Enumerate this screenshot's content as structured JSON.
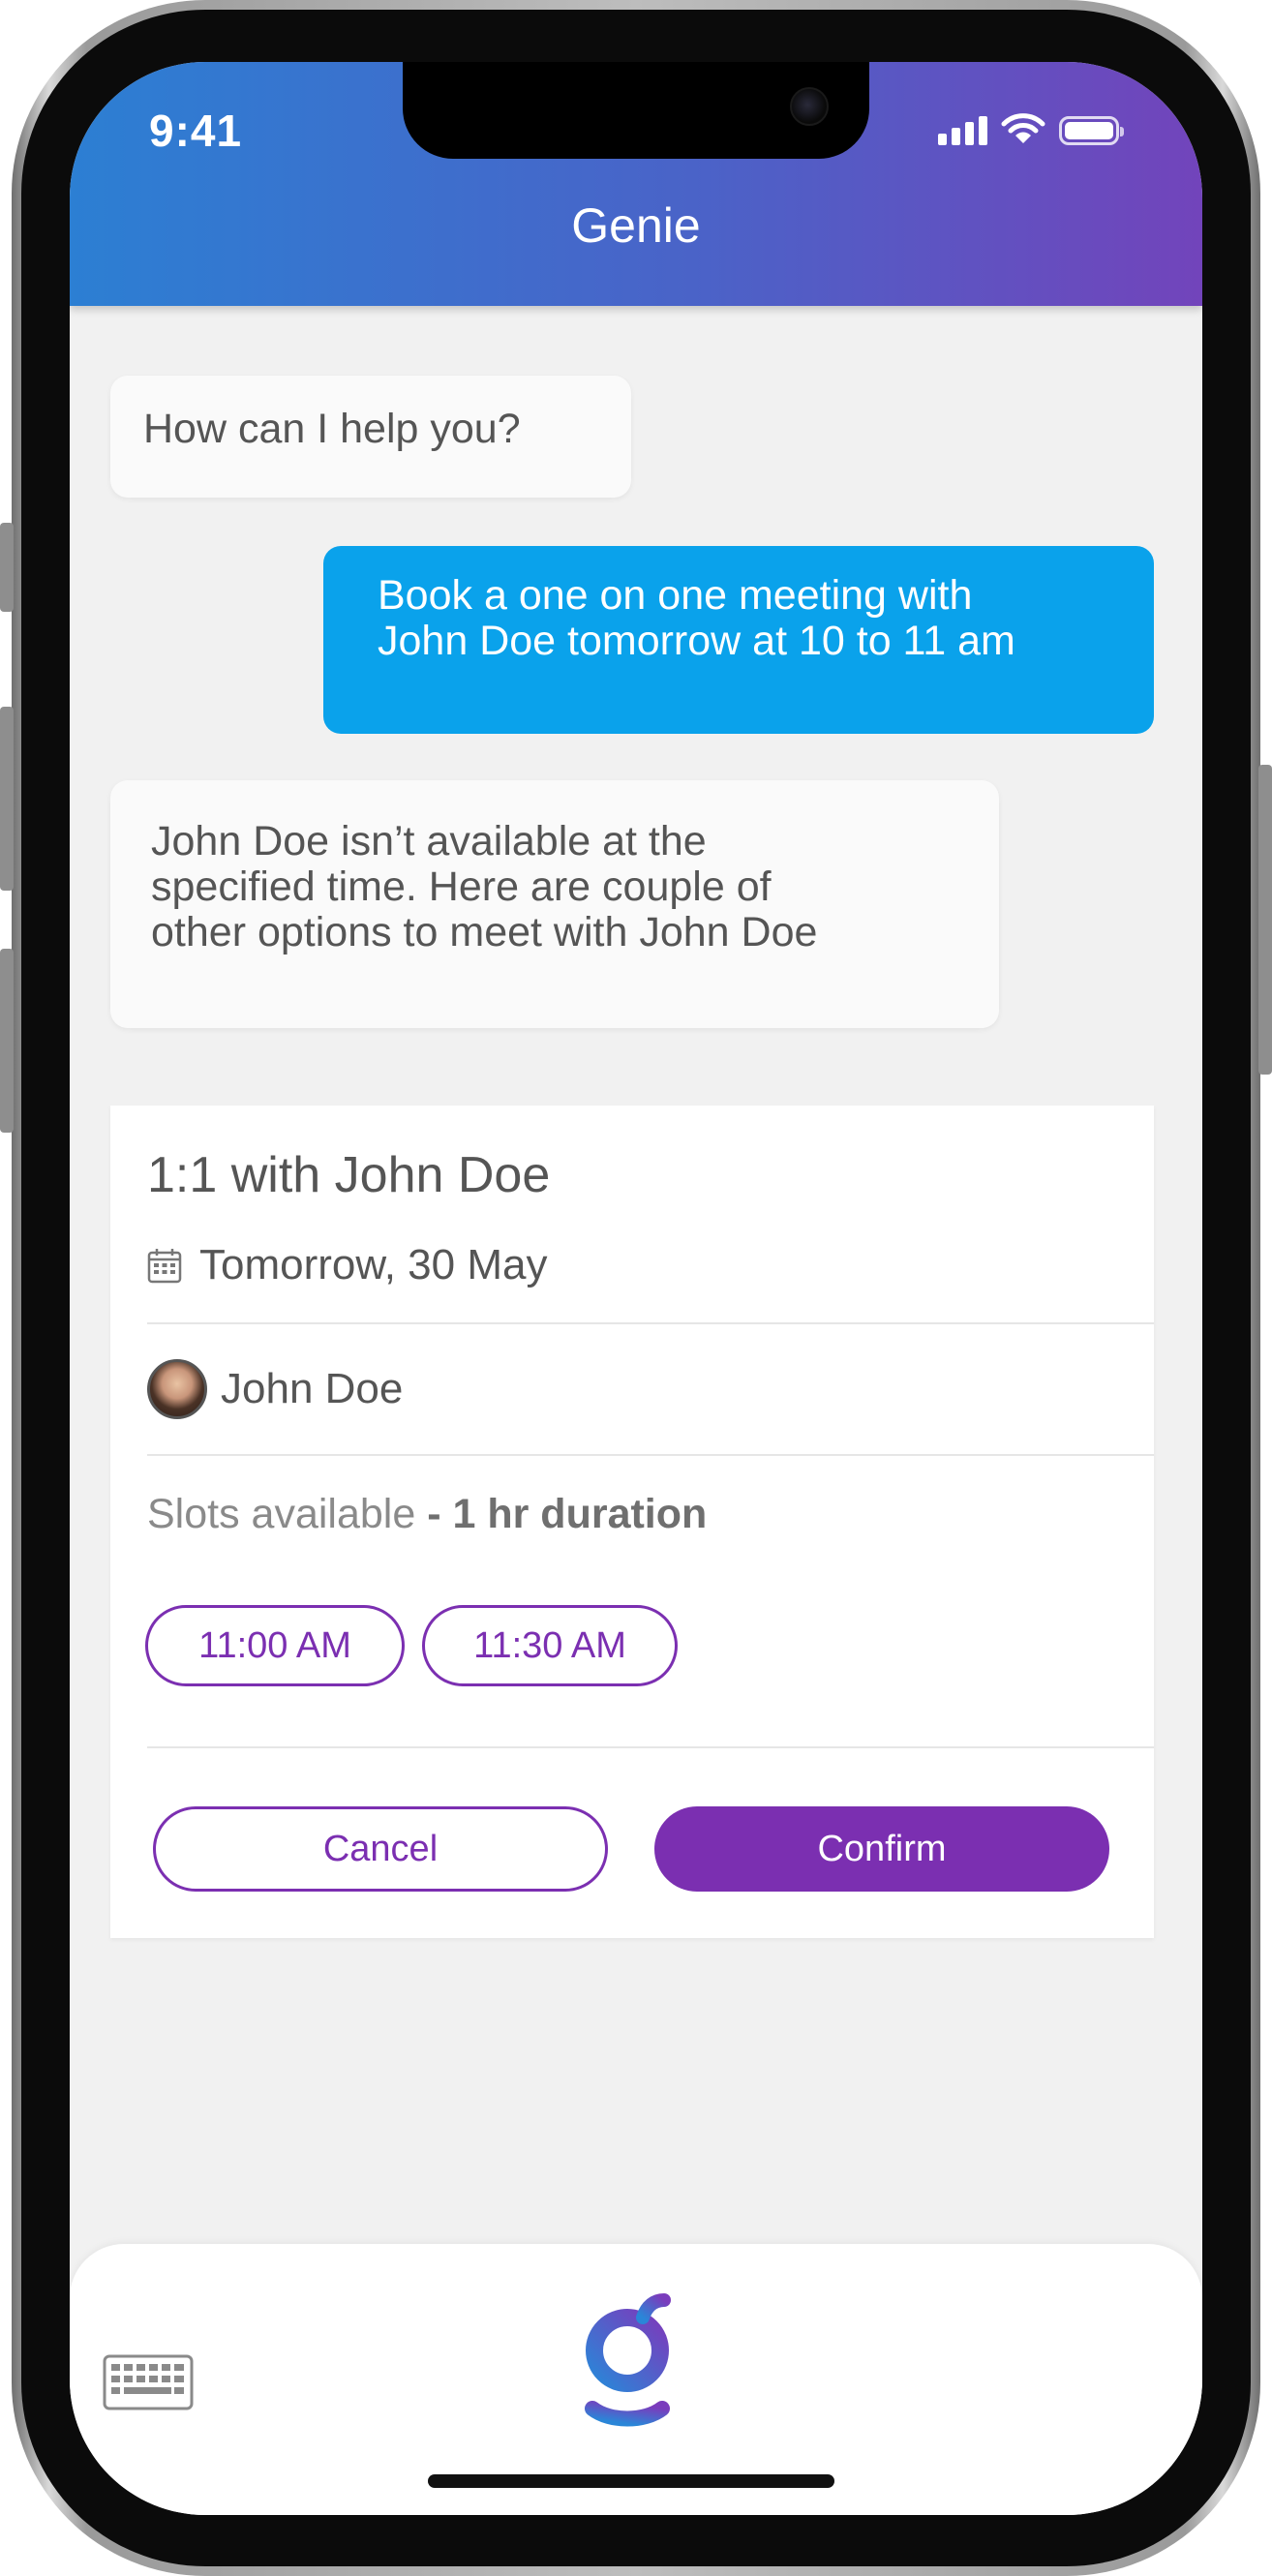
{
  "status_bar": {
    "time": "9:41"
  },
  "header": {
    "title": "Genie"
  },
  "chat": {
    "messages": [
      {
        "sender": "bot",
        "lines": [
          "How can I help you?"
        ]
      },
      {
        "sender": "user",
        "lines": [
          "Book a one on one meeting with",
          "John Doe tomorrow at 10 to 11 am"
        ]
      },
      {
        "sender": "bot",
        "lines": [
          "John Doe isn’t available at the",
          "specified time. Here are couple of",
          "other options to meet with John Doe"
        ]
      }
    ]
  },
  "meeting_card": {
    "title": "1:1 with John Doe",
    "date": "Tomorrow, 30 May",
    "attendee": "John Doe",
    "slots_label": "Slots available",
    "slots_separator": " - ",
    "duration": "1 hr duration",
    "slots": [
      "11:00 AM",
      "11:30 AM"
    ],
    "cancel_label": "Cancel",
    "confirm_label": "Confirm"
  },
  "colors": {
    "accent": "#7b2fb1",
    "user_bubble": "#0aa2eb",
    "header_start": "#2c7fd3",
    "header_end": "#7244bb"
  },
  "icons": {
    "calendar": "calendar-icon",
    "keyboard": "keyboard-icon",
    "logo": "genie-logo-icon",
    "signal": "cellular-signal-icon",
    "wifi": "wifi-icon",
    "battery": "battery-icon"
  }
}
